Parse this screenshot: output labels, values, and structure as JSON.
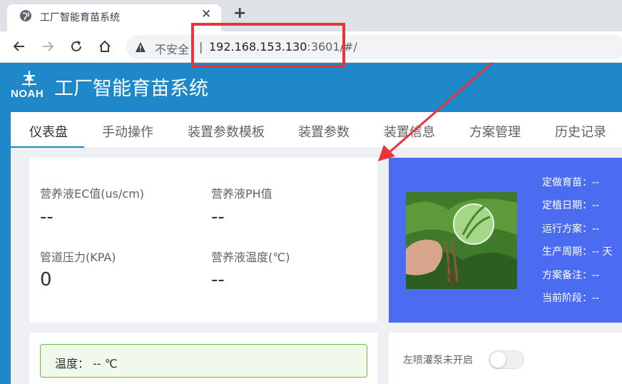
{
  "browser": {
    "tab_title": "工厂智能育苗系统",
    "close_glyph": "✕",
    "newtab_glyph": "+",
    "security_label": "不安全",
    "separator": "|",
    "url_host": "192.168.153.130",
    "url_rest": ":3601/#/"
  },
  "app": {
    "logo_text": "NOAH",
    "title": "工厂智能育苗系统",
    "brand_color": "#1e88c9"
  },
  "nav": {
    "tabs": [
      "仪表盘",
      "手动操作",
      "装置参数模板",
      "装置参数",
      "装置信息",
      "方案管理",
      "历史记录"
    ]
  },
  "sensors": {
    "ec_label": "营养液EC值(us/cm)",
    "ec_value": "--",
    "ph_label": "营养液PH值",
    "ph_value": "--",
    "pressure_label": "管道压力(KPA)",
    "pressure_value": "0",
    "temp_label": "营养液温度(℃)",
    "temp_value": "--"
  },
  "plan": {
    "lines": [
      "定做育苗：--",
      "定植日期：--",
      "运行方案：--",
      "生产周期：-- 天",
      "方案备注：--",
      "当前阶段：--"
    ]
  },
  "ambient": {
    "temperature": "温度： -- ℃"
  },
  "pump": {
    "label": "左喷灌泵未开启",
    "on": false
  },
  "annotation": {
    "color": "#e8353a"
  }
}
